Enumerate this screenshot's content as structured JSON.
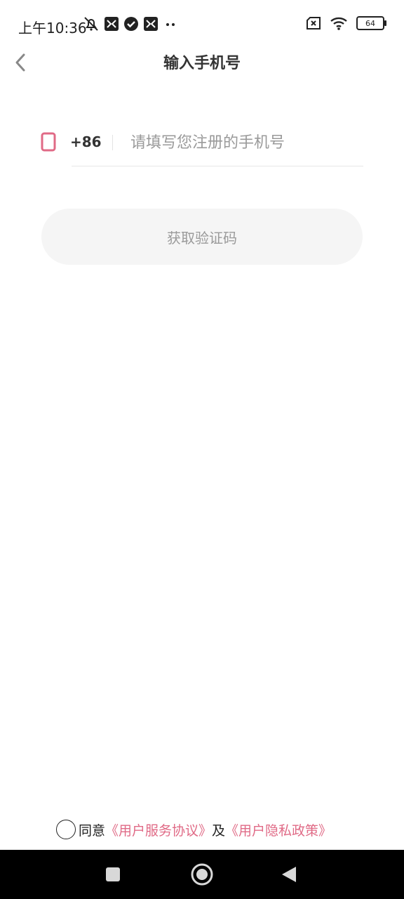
{
  "status_bar": {
    "time": "上午10:36",
    "battery": "64",
    "icons_left": [
      "bell-off-icon",
      "app-icon",
      "check-circle-icon",
      "app-icon",
      "more-dots-icon"
    ],
    "icons_right": [
      "sim-off-icon",
      "wifi-icon",
      "battery-icon"
    ]
  },
  "header": {
    "title": "输入手机号",
    "back_icon": "chevron-left-icon"
  },
  "form": {
    "country_code": "+86",
    "phone_placeholder": "请填写您注册的手机号",
    "phone_value": "",
    "get_code_label": "获取验证码"
  },
  "agreement": {
    "prefix": "同意",
    "terms_link": "《用户服务协议》",
    "conjunction": "及",
    "privacy_link": "《用户隐私政策》"
  },
  "colors": {
    "accent": "#e06a86",
    "button_bg": "#f5f5f5",
    "placeholder": "#9a9a9a"
  }
}
